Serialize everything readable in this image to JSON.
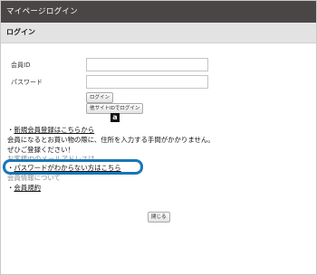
{
  "window": {
    "title": "マイページログイン"
  },
  "section": {
    "title": "ログイン"
  },
  "form": {
    "member_id_label": "会員ID",
    "password_label": "パスワード",
    "member_id_value": "",
    "password_value": "",
    "login_button": "ログイン",
    "other_login_button": "他サイトIDでログイン",
    "amazon_badge": "a"
  },
  "links": {
    "register_bullet": "・",
    "register_link": "新規会員登録はこちらから",
    "info_line1": "会員になるとお買い物の際に、住所を入力する手間がかかりません。",
    "info_line2": "ぜひご登録ください！",
    "info_line3": "お客様IDのメールアドレスは",
    "forgot_bullet": "・",
    "forgot_link": "パスワードがわからない方はこちら",
    "faded_line": "会員情報について",
    "terms_bullet": "・",
    "terms_link": "会員規約"
  },
  "footer": {
    "close_button": "閉じる"
  },
  "colors": {
    "titlebar": "#4a4646",
    "highlight": "#1877b8"
  }
}
